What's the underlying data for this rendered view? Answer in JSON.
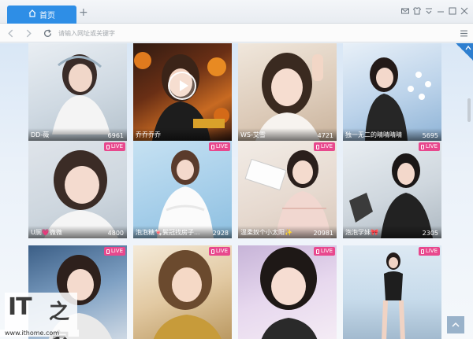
{
  "browser": {
    "tab": {
      "label": "首页",
      "icon": "home-icon"
    },
    "new_tab_label": "+",
    "address_placeholder": "请输入网址或关键字",
    "window_controls": [
      "mail-icon",
      "skin-icon",
      "menu-down-icon",
      "minimize-icon",
      "maximize-icon",
      "close-icon"
    ]
  },
  "feed": {
    "live_label": "LIVE",
    "cards": [
      {
        "name": "DD-薇",
        "count": "6961",
        "live": false,
        "play": false
      },
      {
        "name": "乔乔乔乔",
        "count": "",
        "live": false,
        "play": true
      },
      {
        "name": "WS-艾雪",
        "count": "4721",
        "live": false,
        "play": false
      },
      {
        "name": "独一无二的晴晴晴晴",
        "count": "5695",
        "live": false,
        "play": false
      },
      {
        "name": "U厕💗微微",
        "count": "4800",
        "live": true,
        "play": false
      },
      {
        "name": "泡泡糖🍬鬓冠找房子...",
        "count": "2928",
        "live": true,
        "play": false
      },
      {
        "name": "温柔奴个小太阳✨",
        "count": "20981",
        "live": true,
        "play": false
      },
      {
        "name": "泡泡学妹🎀",
        "count": "2305",
        "live": true,
        "play": false
      },
      {
        "name": "",
        "count": "",
        "live": true,
        "play": false
      },
      {
        "name": "",
        "count": "",
        "live": true,
        "play": false
      },
      {
        "name": "",
        "count": "",
        "live": true,
        "play": false
      },
      {
        "name": "",
        "count": "",
        "live": true,
        "play": false
      }
    ]
  },
  "watermark": {
    "brand": "IT",
    "brand_zh": "之家",
    "url": "www.ithome.com"
  },
  "colors": {
    "accent": "#2e8ee6",
    "live": "#e8488d"
  }
}
